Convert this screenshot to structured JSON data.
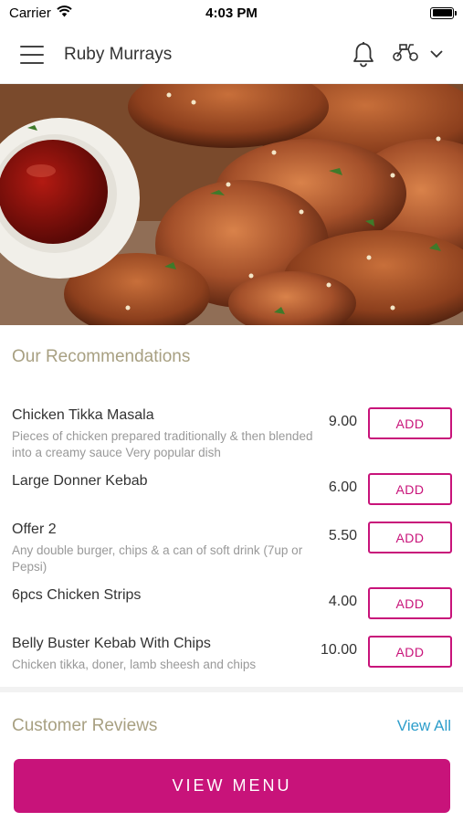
{
  "status_bar": {
    "carrier": "Carrier",
    "time": "4:03 PM"
  },
  "header": {
    "title": "Ruby Murrays"
  },
  "recommendations": {
    "title": "Our Recommendations",
    "items": [
      {
        "name": "Chicken Tikka Masala",
        "description": "Pieces of chicken prepared traditionally & then blended into a creamy sauce  Very popular dish",
        "price": "9.00",
        "add_label": "ADD"
      },
      {
        "name": "Large Donner Kebab",
        "description": "",
        "price": "6.00",
        "add_label": "ADD"
      },
      {
        "name": "Offer 2",
        "description": "Any double burger, chips & a can of soft drink (7up or Pepsi)",
        "price": "5.50",
        "add_label": "ADD"
      },
      {
        "name": "6pcs Chicken Strips",
        "description": "",
        "price": "4.00",
        "add_label": "ADD"
      },
      {
        "name": "Belly Buster Kebab With Chips",
        "description": "Chicken tikka, doner, lamb sheesh and chips",
        "price": "10.00",
        "add_label": "ADD"
      }
    ]
  },
  "reviews": {
    "title": "Customer Reviews",
    "view_all_label": "View All"
  },
  "footer": {
    "view_menu_label": "VIEW MENU"
  },
  "icons": {
    "menu": "hamburger-menu-icon",
    "notifications": "bell-icon",
    "delivery": "scooter-icon",
    "dropdown": "chevron-down-icon",
    "wifi": "wifi-icon",
    "battery": "battery-icon"
  },
  "colors": {
    "accent": "#c8137a",
    "section_title": "#a8a082",
    "link": "#2e9ecb"
  }
}
